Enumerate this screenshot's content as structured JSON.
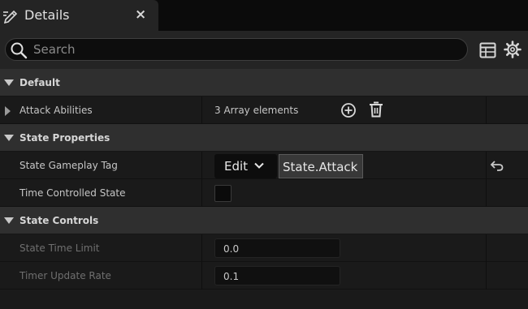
{
  "tab": {
    "title": "Details",
    "close_glyph": "×",
    "icon": "pencil-icon"
  },
  "search": {
    "placeholder": "Search",
    "value": ""
  },
  "toolbar": {
    "table_icon": "table-icon",
    "settings_icon": "gear-icon"
  },
  "categories": {
    "default": {
      "label": "Default",
      "rows": {
        "attack_abilities": {
          "name": "Attack Abilities",
          "value": "3 Array elements"
        }
      }
    },
    "state_properties": {
      "label": "State Properties",
      "rows": {
        "gameplay_tag": {
          "name": "State Gameplay Tag",
          "edit_label": "Edit",
          "tag": "State.Attack"
        },
        "time_controlled": {
          "name": "Time Controlled State",
          "checked": false
        }
      }
    },
    "state_controls": {
      "label": "State Controls",
      "rows": {
        "time_limit": {
          "name": "State Time Limit",
          "value": "0.0"
        },
        "update_rate": {
          "name": "Timer Update Rate",
          "value": "0.1"
        }
      }
    }
  },
  "colors": {
    "background": "#151515",
    "category": "#2f2f2f",
    "row": "#1a1a1a",
    "field": "#101010"
  }
}
